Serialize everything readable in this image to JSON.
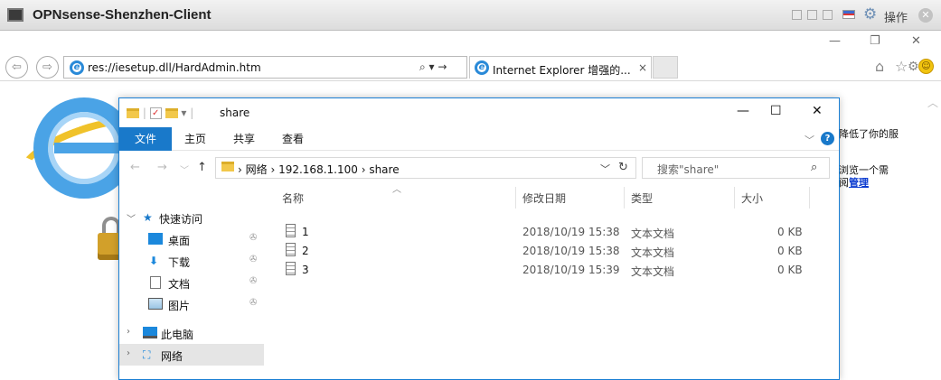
{
  "vm": {
    "title": "OPNsense-Shenzhen-Client",
    "action_label": "操作"
  },
  "ie": {
    "address": "res://iesetup.dll/HardAdmin.htm",
    "tab_title": "Internet Explorer 增强的...",
    "tab_close": "×",
    "side_text": {
      "line1": "降低了你的服",
      "line2": "浏览一个需",
      "line3_prefix": "阅",
      "line3_link": "管理"
    }
  },
  "explorer": {
    "title": "share",
    "ribbon_tabs": [
      "文件",
      "主页",
      "共享",
      "查看"
    ],
    "breadcrumb": [
      "网络",
      "192.168.1.100",
      "share"
    ],
    "search_placeholder": "搜索\"share\"",
    "nav": {
      "quick_access": "快速访问",
      "pinned": [
        "桌面",
        "下载",
        "文档",
        "图片"
      ],
      "this_pc": "此电脑",
      "network": "网络"
    },
    "columns": [
      "名称",
      "修改日期",
      "类型",
      "大小"
    ],
    "files": [
      {
        "name": "1",
        "date": "2018/10/19 15:38",
        "type": "文本文档",
        "size": "0 KB"
      },
      {
        "name": "2",
        "date": "2018/10/19 15:38",
        "type": "文本文档",
        "size": "0 KB"
      },
      {
        "name": "3",
        "date": "2018/10/19 15:39",
        "type": "文本文档",
        "size": "0 KB"
      }
    ]
  },
  "colors": {
    "accent": "#1979ca",
    "selection": "#e5e5e5",
    "link": "#0b3bd0"
  }
}
